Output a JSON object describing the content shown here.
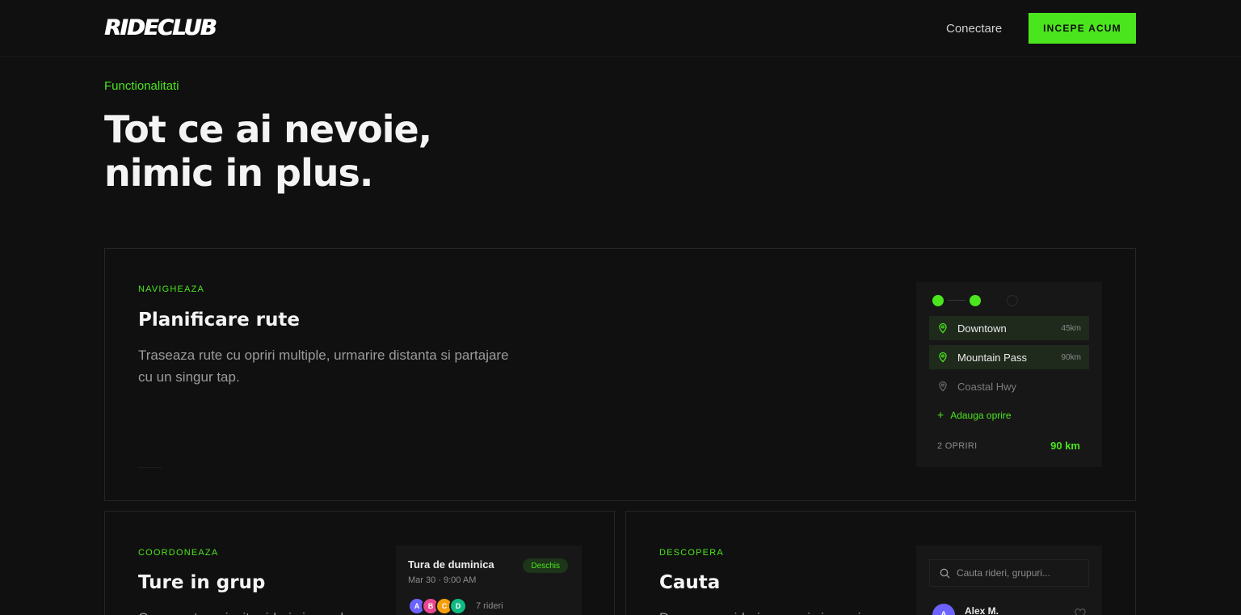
{
  "header": {
    "logo": "RIDECLUB",
    "login_label": "Conectare",
    "cta_label": "INCEPE ACUM"
  },
  "hero": {
    "eyebrow": "Functionalitati",
    "title_line1": "Tot ce ai nevoie,",
    "title_line2": "nimic in plus."
  },
  "colors": {
    "accent": "#4be51d",
    "background": "#101010",
    "panel": "#171717"
  },
  "features": {
    "routes": {
      "tag": "NAVIGHEAZA",
      "title": "Planificare rute",
      "description": "Traseaza rute cu opriri multiple, urmarire distanta si partajare cu un singur tap.",
      "widget": {
        "stops": [
          {
            "name": "Downtown",
            "distance": "45km",
            "active": true
          },
          {
            "name": "Mountain Pass",
            "distance": "90km",
            "active": true
          },
          {
            "name": "Coastal Hwy",
            "distance": "",
            "active": false
          }
        ],
        "add_stop_label": "Adauga oprire",
        "stops_count_label": "2 OPRIRI",
        "total_distance": "90 km"
      }
    },
    "group": {
      "tag": "COORDONEAZA",
      "title": "Ture in grup",
      "description": "Creeaza ture, invita rideri si coordoneaza",
      "widget": {
        "ride_name": "Tura de duminica",
        "status_badge": "Deschis",
        "date": "Mar 30 · 9:00 AM",
        "avatars": [
          {
            "initial": "A",
            "color": "#6c63ff"
          },
          {
            "initial": "B",
            "color": "#e8488f"
          },
          {
            "initial": "C",
            "color": "#f59e0b"
          },
          {
            "initial": "D",
            "color": "#10b981"
          }
        ],
        "riders_count": "7 rideri"
      }
    },
    "search": {
      "tag": "DESCOPERA",
      "title": "Cauta",
      "description": "Descopera rideri, grupuri si evenimente",
      "widget": {
        "placeholder": "Cauta rideri, grupuri...",
        "user_initial": "A",
        "user_name": "Alex M."
      }
    }
  }
}
